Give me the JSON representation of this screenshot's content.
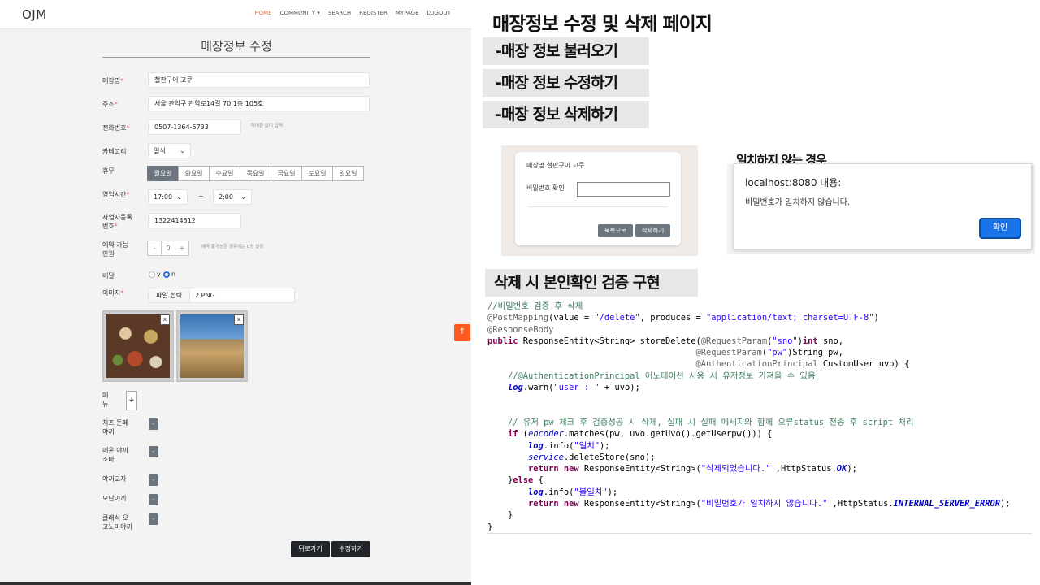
{
  "nav": {
    "logo": "OJM",
    "items": [
      "HOME",
      "COMMUNITY ▾",
      "SEARCH",
      "REGISTER",
      "MYPAGE",
      "LOGOUT"
    ]
  },
  "form": {
    "title": "매장정보 수정",
    "labels": {
      "name": "매장명",
      "address": "주소",
      "phone": "전화번호",
      "category": "카테고리",
      "holiday": "휴무",
      "hours": "영업시간",
      "biz1": "사업자등록",
      "biz2": "번호",
      "res1": "예약 가능",
      "res2": "인원",
      "delivery": "배달",
      "image": "이미지",
      "menu1": "메",
      "menu2": "뉴"
    },
    "required_mark": "*",
    "values": {
      "name": "철판구이 고쿠",
      "address": "서울 관악구 관악로14길 70 1층 105호",
      "phone": "0507-1364-5733",
      "phone_hint": "하이픈 없이 입력",
      "category": "일식",
      "open": "17:00",
      "tilde": "~",
      "close": "2:00",
      "biz_no": "1322414512",
      "res_minus": "-",
      "res_count": "0",
      "res_plus": "+",
      "res_hint": "예약 불가능한 경우에는 0명 설정",
      "delivery_y": "y",
      "delivery_n": "n",
      "file_btn": "파일 선택",
      "file_name": "2.PNG",
      "close_x": "x",
      "add_menu": "+",
      "minus": "-"
    },
    "days": [
      "월요일",
      "화요일",
      "수요일",
      "목요일",
      "금요일",
      "토요일",
      "일요일"
    ],
    "menus": [
      [
        "치즈 돈페",
        "야끼"
      ],
      [
        "매운 야끼",
        "소바"
      ],
      [
        "야끼교자",
        ""
      ],
      [
        "모단야끼",
        ""
      ],
      [
        "클래식 오",
        "코노미야끼"
      ]
    ],
    "back_button": "뒤로가기",
    "save_button": "수정하기",
    "scroll_top": "↑"
  },
  "slide": {
    "title": "매장정보 수정 및 삭제 페이지",
    "bullets": [
      "-매장 정보 불러오기",
      "-매장 정보 수정하기",
      "-매장 정보 삭제하기"
    ],
    "verify_heading": "삭제 시 본인확인 검증 구현",
    "mismatch_heading": "일치하지 않는 경우"
  },
  "delete_dialog": {
    "store_line": "매장명  철판구이 고쿠",
    "pw_label": "비밀번호 확인",
    "list_button": "목록으로",
    "delete_button": "삭제하기"
  },
  "alert": {
    "host": "localhost:8080 내용:",
    "message": "비밀번호가 일치하지 않습니다.",
    "ok": "확인"
  },
  "code": {
    "c1": "//비밀번호 검증 후 삭제",
    "c2": "@PostMapping",
    "c3": "(value = ",
    "c4": "\"/delete\"",
    "c5": ", produces = ",
    "c6": "\"application/text; charset=UTF-8\"",
    "c7": ")",
    "c8": "@ResponseBody",
    "c9": "public",
    "c10": " ResponseEntity<String> storeDelete(",
    "c11": "@RequestParam",
    "c12": "(",
    "c13": "\"sno\"",
    "c14": ")",
    "c15": "int",
    "c16": " sno,",
    "c17": "                                         ",
    "c18": "@RequestParam",
    "c19": "(",
    "c20": "\"pw\"",
    "c21": ")String pw,",
    "c22": "                                         ",
    "c23": "@AuthenticationPrincipal",
    "c24": " CustomUser uvo) {",
    "c25": "    ",
    "c26": "//@AuthenticationPrincipal 어노테이션 사용 시 유저정보 가져올 수 있음",
    "c27": "    ",
    "c28": "log",
    "c29": ".warn(",
    "c30": "\"user : \"",
    "c31": " + uvo);",
    "c32": "    ",
    "c33": "// 유저 pw 체크 후 검증성공 시 삭제, 실패 시 실패 메세지와 함께 오류status 전송 후 script 처리",
    "c34": "    ",
    "c35": "if",
    "c36": " (",
    "c37": "encoder",
    "c38": ".matches(pw, uvo.getUvo().getUserpw())) {",
    "c39": "        ",
    "c40": "log",
    "c41": ".info(",
    "c42": "\"일치\"",
    "c43": ");",
    "c44": "        ",
    "c45": "service",
    "c46": ".deleteStore(sno);",
    "c47": "        ",
    "c48": "return",
    "c49": " ",
    "c50": "new",
    "c51": " ResponseEntity<String>(",
    "c52": "\"삭제되었습니다.\"",
    "c53": " ,HttpStatus.",
    "c54": "OK",
    "c55": ");",
    "c56": "    }",
    "c57": "else",
    "c58": " {",
    "c59": "        ",
    "c60": "log",
    "c61": ".info(",
    "c62": "\"불일치\"",
    "c63": ");",
    "c64": "        ",
    "c65": "return",
    "c66": " ",
    "c67": "new",
    "c68": " ResponseEntity<String>(",
    "c69": "\"비밀번호가 일치하지 않습니다.\"",
    "c70": " ,HttpStatus.",
    "c71": "INTERNAL_SERVER_ERROR",
    "c72": ");",
    "c73": "    }",
    "c74": "}"
  },
  "colors": {
    "nav_active": "#e8743b",
    "day_selected": "#6c757d",
    "button_dark": "#212529",
    "scroll_top": "#ff5a1f",
    "alert_ok": "#1a73e8"
  }
}
